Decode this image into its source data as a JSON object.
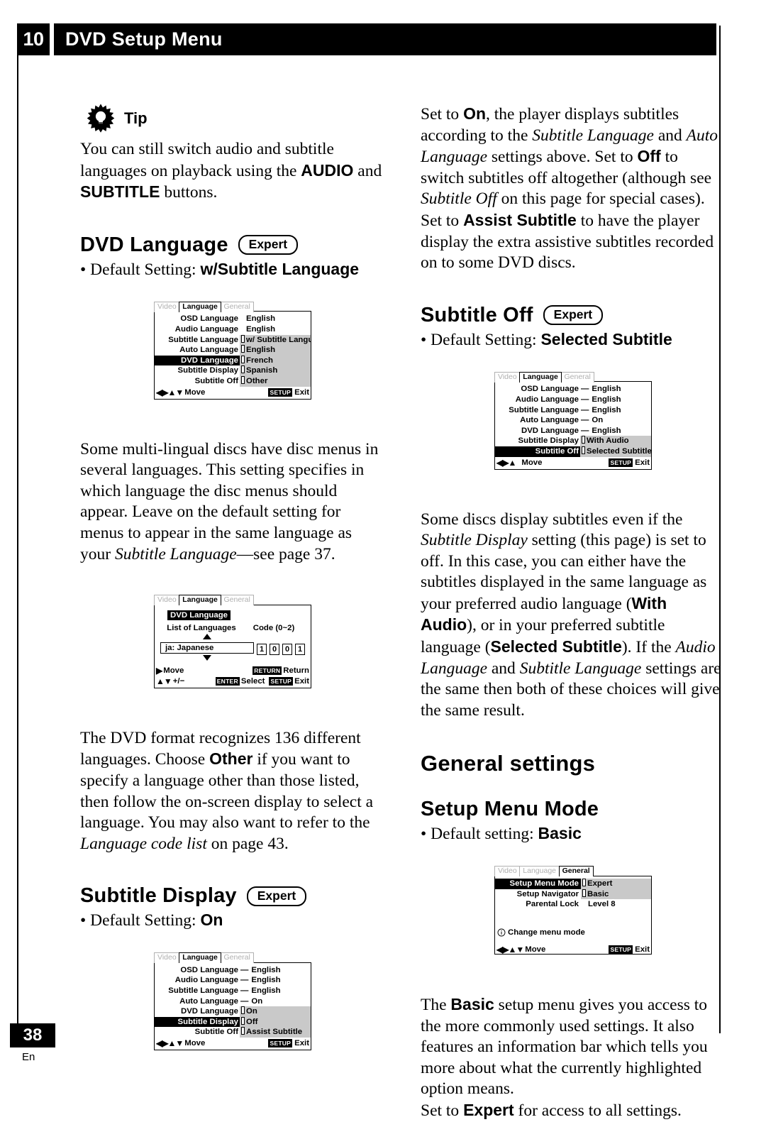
{
  "header": {
    "chapter_number": "10",
    "chapter_title": "DVD Setup Menu"
  },
  "footer": {
    "page_number": "38",
    "language_code": "En"
  },
  "left_column": {
    "tip": {
      "icon": "lightbulb-icon",
      "label": "Tip",
      "text_1": "You can still switch audio and subtitle languages on playback using the ",
      "audio_button": "AUDIO",
      "text_2": " and ",
      "subtitle_button": "SUBTITLE",
      "text_3": " buttons."
    },
    "dvd_language": {
      "heading": "DVD Language",
      "badge": "Expert",
      "default_prefix": "• Default Setting: ",
      "default_value": "w/Subtitle Language"
    },
    "paragraph_dvd_language": {
      "part_1": "Some multi-lingual discs have disc menus in several languages. This setting specifies in which language the disc menus should appear. Leave on the default setting for menus to appear in the same language as your ",
      "italic_1": "Subtitle Language",
      "part_2": "—see page 37."
    },
    "paragraph_other": {
      "part_1": "The DVD format recognizes 136 different languages. Choose ",
      "bold_1": "Other",
      "part_2": " if you want to specify a language other than those listed, then follow the on-screen display to select a language. You may also want to refer to the ",
      "italic_1": "Language code list",
      "part_3": " on page 43."
    },
    "subtitle_display": {
      "heading": "Subtitle Display",
      "badge": "Expert",
      "default_prefix": "• Default Setting: ",
      "default_value": "On"
    }
  },
  "right_column": {
    "paragraph_subtitle_display": {
      "part_1": "Set to ",
      "bold_1": "On",
      "part_2": ", the player displays subtitles according to the ",
      "italic_1": "Subtitle Language",
      "part_3": " and ",
      "italic_2": "Auto Language",
      "part_4": " settings above. Set to ",
      "bold_2": "Off",
      "part_5": " to switch subtitles off altogether (although see ",
      "italic_3": "Subtitle Off",
      "part_6": " on this page for special cases). Set to ",
      "bold_3": "Assist Subtitle",
      "part_7": " to have the player display the extra assistive subtitles recorded on to some DVD discs."
    },
    "subtitle_off": {
      "heading": "Subtitle Off",
      "badge": "Expert",
      "default_prefix": "• Default Setting: ",
      "default_value": "Selected Subtitle"
    },
    "paragraph_subtitle_off": {
      "part_1": "Some discs display subtitles even if the ",
      "italic_1": "Subtitle Display",
      "part_2": " setting (this page) is set to off. In this case, you can either have the subtitles displayed in the same language as your preferred audio language (",
      "bold_1": "With Audio",
      "part_3": "), or in your preferred subtitle language (",
      "bold_2": "Selected Subtitle",
      "part_4": "). If the ",
      "italic_2": "Audio Language",
      "part_5": " and ",
      "italic_3": "Subtitle Language",
      "part_6": " settings are the same then both of these choices will give the same result."
    },
    "general_settings": {
      "heading": "General settings"
    },
    "setup_menu_mode": {
      "heading": "Setup Menu Mode",
      "default_prefix": "• Default setting: ",
      "default_value": "Basic"
    },
    "paragraph_basic": {
      "part_1": "The ",
      "bold_1": "Basic",
      "part_2": " setup menu gives you access to the more commonly used settings. It also features an information bar which tells you more about what the currently highlighted option means."
    },
    "paragraph_expert": {
      "part_1": "Set to ",
      "bold_1": "Expert",
      "part_2": " for access to all settings."
    }
  },
  "osd_screens": {
    "dvd_language_menu": {
      "tabs": [
        {
          "label": "Video",
          "state": "dim"
        },
        {
          "label": "Language",
          "state": "active"
        },
        {
          "label": "General",
          "state": "dim"
        }
      ],
      "rows": [
        {
          "label": "OSD Language",
          "value": "English",
          "dash": "",
          "highlighted": false
        },
        {
          "label": "Audio Language",
          "value": "English",
          "dash": "",
          "highlighted": false
        },
        {
          "label": "Subtitle Language",
          "value": "",
          "dash": "",
          "highlighted": false
        },
        {
          "label": "Auto Language",
          "value": "",
          "dash": "-",
          "highlighted": false
        },
        {
          "label": "DVD Language",
          "value": "",
          "dash": "",
          "highlighted": true
        },
        {
          "label": "Subtitle Display",
          "value": "",
          "dash": "-",
          "highlighted": false
        },
        {
          "label": "Subtitle Off",
          "value": "",
          "dash": "-",
          "highlighted": false
        }
      ],
      "popup_items": [
        "w/ Subtitle Language",
        "English",
        "French",
        "Spanish",
        "Other"
      ],
      "footer": {
        "move_label": "Move",
        "exit_key": "SETUP",
        "exit_label": "Exit"
      }
    },
    "language_code_entry": {
      "tabs": [
        {
          "label": "Video",
          "state": "dim"
        },
        {
          "label": "Language",
          "state": "active"
        },
        {
          "label": "General",
          "state": "dim"
        }
      ],
      "title": "DVD Language",
      "list_label": "List of Languages",
      "code_label": "Code (0~2)",
      "selected_language": "ja: Japanese",
      "code_digits": [
        "1",
        "0",
        "0",
        "1"
      ],
      "footer": {
        "move_label": "Move",
        "plusminus_label": "+/−",
        "enter_key": "ENTER",
        "select_label": "Select",
        "return_key": "RETURN",
        "return_label": "Return",
        "exit_key": "SETUP",
        "exit_label": "Exit"
      }
    },
    "subtitle_display_menu": {
      "tabs": [
        {
          "label": "Video",
          "state": "dim"
        },
        {
          "label": "Language",
          "state": "active"
        },
        {
          "label": "General",
          "state": "dim"
        }
      ],
      "rows": [
        {
          "label": "OSD Language",
          "value": "English",
          "dash": "—",
          "highlighted": false
        },
        {
          "label": "Audio Language",
          "value": "English",
          "dash": "—",
          "highlighted": false
        },
        {
          "label": "Subtitle Language",
          "value": "English",
          "dash": "—",
          "highlighted": false
        },
        {
          "label": "Auto Language",
          "value": "On",
          "dash": "—",
          "highlighted": false
        },
        {
          "label": "DVD Language",
          "value": "",
          "dash": "-",
          "highlighted": false
        },
        {
          "label": "Subtitle Display",
          "value": "",
          "dash": "",
          "highlighted": true
        },
        {
          "label": "Subtitle Off",
          "value": "",
          "dash": "-",
          "highlighted": false
        }
      ],
      "popup_items": [
        "On",
        "Off",
        "Assist Subtitle"
      ],
      "footer": {
        "move_label": "Move",
        "exit_key": "SETUP",
        "exit_label": "Exit"
      }
    },
    "subtitle_off_menu": {
      "tabs": [
        {
          "label": "Video",
          "state": "dim"
        },
        {
          "label": "Language",
          "state": "active"
        },
        {
          "label": "General",
          "state": "dim"
        }
      ],
      "rows": [
        {
          "label": "OSD Language",
          "value": "English",
          "dash": "—",
          "highlighted": false
        },
        {
          "label": "Audio Language",
          "value": "English",
          "dash": "—",
          "highlighted": false
        },
        {
          "label": "Subtitle Language",
          "value": "English",
          "dash": "—",
          "highlighted": false
        },
        {
          "label": "Auto Language",
          "value": "On",
          "dash": "—",
          "highlighted": false
        },
        {
          "label": "DVD Language",
          "value": "English",
          "dash": "—",
          "highlighted": false
        },
        {
          "label": "Subtitle Display",
          "value": "",
          "dash": "-",
          "highlighted": false
        },
        {
          "label": "Subtitle Off",
          "value": "",
          "dash": "",
          "highlighted": true
        }
      ],
      "popup_items": [
        "With Audio",
        "Selected Subtitle"
      ],
      "footer": {
        "move_label": "Move",
        "exit_key": "SETUP",
        "exit_label": "Exit"
      }
    },
    "general_menu": {
      "tabs": [
        {
          "label": "Video",
          "state": "dim"
        },
        {
          "label": "Language",
          "state": "dim"
        },
        {
          "label": "General",
          "state": "active"
        }
      ],
      "rows": [
        {
          "label": "Setup Menu Mode",
          "value": "Expert",
          "highlighted": true,
          "shaded": true
        },
        {
          "label": "Setup Navigator",
          "value": "Basic",
          "highlighted": false,
          "shaded": true
        },
        {
          "label": "Parental Lock",
          "value": "Level 8",
          "highlighted": false,
          "shaded": false
        }
      ],
      "info_icon": "info-circle-icon",
      "info_text": "Change menu mode",
      "footer": {
        "move_label": "Move",
        "exit_key": "SETUP",
        "exit_label": "Exit"
      }
    }
  }
}
